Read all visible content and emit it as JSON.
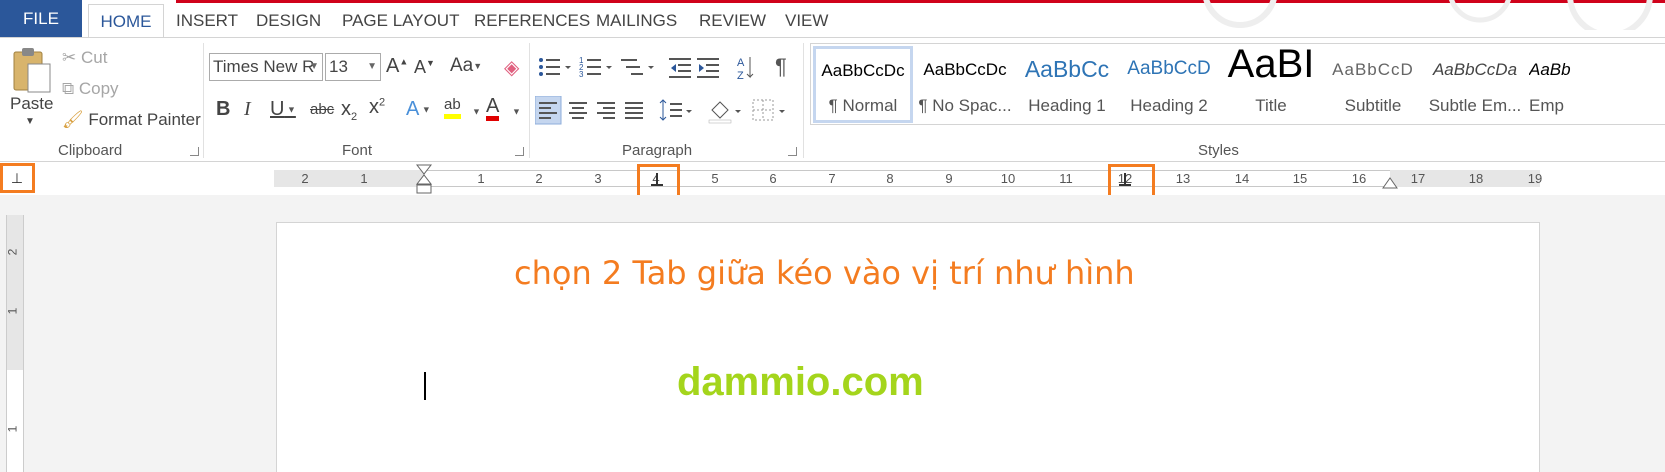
{
  "tabs": [
    {
      "label": "FILE"
    },
    {
      "label": "HOME"
    },
    {
      "label": "INSERT"
    },
    {
      "label": "DESIGN"
    },
    {
      "label": "PAGE LAYOUT"
    },
    {
      "label": "REFERENCES"
    },
    {
      "label": "MAILINGS"
    },
    {
      "label": "REVIEW"
    },
    {
      "label": "VIEW"
    }
  ],
  "clipboard": {
    "paste_label": "Paste",
    "cut_label": "Cut",
    "copy_label": "Copy",
    "format_painter_label": "Format Painter",
    "group_label": "Clipboard"
  },
  "font": {
    "font_name": "Times New R",
    "font_size": "13",
    "change_case": "Aa",
    "group_label": "Font"
  },
  "paragraph": {
    "group_label": "Paragraph"
  },
  "styles": {
    "group_label": "Styles",
    "items": [
      {
        "preview": "AaBbCcDc",
        "name": "¶ Normal",
        "selected": true
      },
      {
        "preview": "AaBbCcDc",
        "name": "¶ No Spac..."
      },
      {
        "preview": "AaBbCc",
        "name": "Heading 1"
      },
      {
        "preview": "AaBbCcD",
        "name": "Heading 2"
      },
      {
        "preview": "AaBI",
        "name": "Title"
      },
      {
        "preview": "AaBbCcD",
        "name": "Subtitle"
      },
      {
        "preview": "AaBbCcDa",
        "name": "Subtle Em..."
      },
      {
        "preview": "AaBb",
        "name": "Emp"
      }
    ]
  },
  "ruler": {
    "left_numbers": [
      "2",
      "1"
    ],
    "numbers": [
      "1",
      "2",
      "3",
      "4",
      "5",
      "6",
      "7",
      "8",
      "9",
      "10",
      "11",
      "12",
      "13",
      "14",
      "15",
      "16",
      "17",
      "18",
      "19"
    ],
    "vertical_numbers": [
      "2",
      "1",
      "1"
    ]
  },
  "document": {
    "instruction": "chọn 2 Tab giữa kéo vào vị trí như hình",
    "site": "dammio.com"
  },
  "colors": {
    "file_tab": "#2b579a",
    "highlight": "#f47c20",
    "site_text": "#a4d51c",
    "instruction_text": "#f47c20"
  }
}
